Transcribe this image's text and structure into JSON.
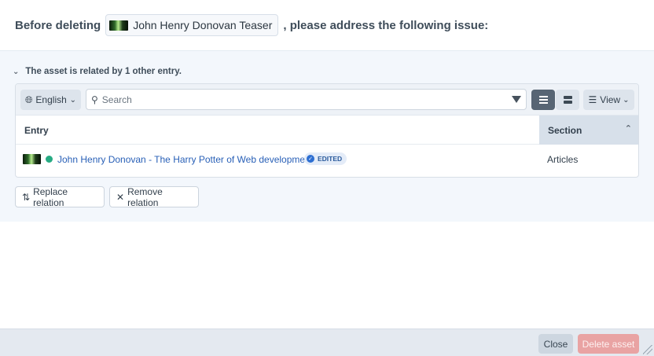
{
  "header": {
    "prefix": "Before deleting",
    "asset_title": "John Henry Donovan Teaser",
    "suffix": ", please address the following issue:"
  },
  "issue": {
    "title": "The asset is related by 1 other entry.",
    "toolbar": {
      "site_label": "English",
      "search_placeholder": "Search",
      "view_menu_label": "View"
    },
    "table": {
      "columns": [
        "Entry",
        "Section"
      ],
      "sort_column": "Section",
      "rows": [
        {
          "entry": "John Henry Donovan - The Harry Potter of Web development",
          "status": "live",
          "badge": "EDITED",
          "section": "Articles"
        }
      ]
    },
    "actions": {
      "replace_label": "Replace relation",
      "remove_label": "Remove relation"
    }
  },
  "footer": {
    "close_label": "Close",
    "delete_label": "Delete asset"
  },
  "colors": {
    "link": "#2960b7",
    "status_live": "#27ab83",
    "delete_button": "#e9a3a3",
    "badge_bg": "#e4ecf8"
  },
  "icons": {
    "site_menu": "globe-icon",
    "search": "search-icon",
    "filter": "filter-icon",
    "view_list": "list-view-icon",
    "view_cards": "card-view-icon",
    "view_menu": "sliders-icon",
    "replace": "swap-arrows-icon",
    "remove": "x-icon"
  }
}
